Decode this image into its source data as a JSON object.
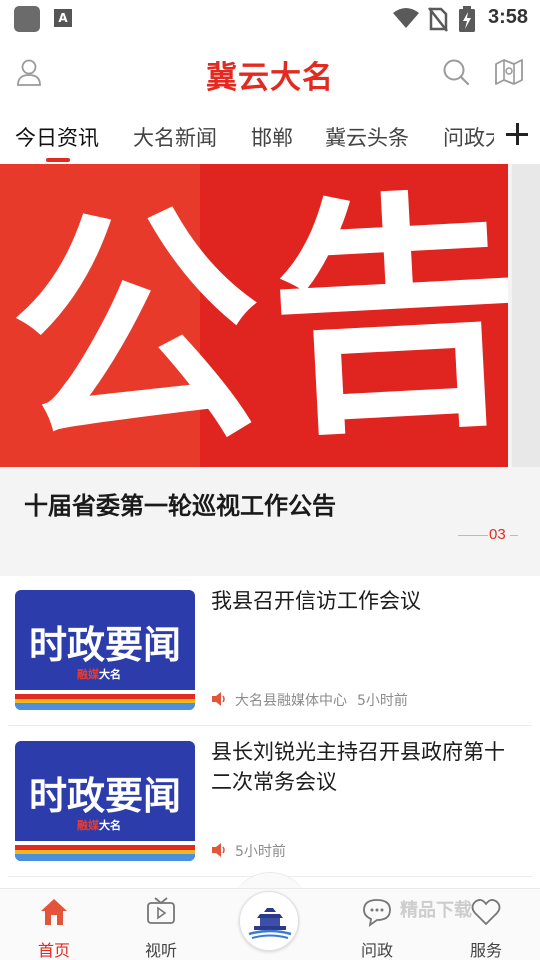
{
  "status_bar": {
    "time": "3:58",
    "notification_badge": "A"
  },
  "header": {
    "title": "冀云大名"
  },
  "tabs": [
    {
      "label": "今日资讯",
      "active": true
    },
    {
      "label": "大名新闻",
      "active": false
    },
    {
      "label": "邯郸",
      "active": false
    },
    {
      "label": "冀云头条",
      "active": false
    },
    {
      "label": "问政大",
      "active": false
    }
  ],
  "banner": {
    "image_text": "公告",
    "title": "十届省委第一轮巡视工作公告",
    "page_indicator": "03"
  },
  "news": [
    {
      "thumb_text": "时政要闻",
      "thumb_logo_red": "融媒",
      "thumb_logo": "大名",
      "title": "我县召开信访工作会议",
      "source": "大名县融媒体中心",
      "time": "5小时前"
    },
    {
      "thumb_text": "时政要闻",
      "thumb_logo_red": "融媒",
      "thumb_logo": "大名",
      "title": "县长刘锐光主持召开县政府第十二次常务会议",
      "source": "",
      "time": "5小时前"
    }
  ],
  "bottom_nav": {
    "items": [
      {
        "label": "首页",
        "icon": "home-icon",
        "active": true
      },
      {
        "label": "视听",
        "icon": "tv-icon",
        "active": false
      },
      {
        "label": "问政",
        "icon": "chat-icon",
        "active": false
      },
      {
        "label": "服务",
        "icon": "heart-icon",
        "active": false
      }
    ],
    "watermark": "精品下载"
  },
  "colors": {
    "brand_red": "#e32a20",
    "thumb_blue": "#2c3dab"
  }
}
